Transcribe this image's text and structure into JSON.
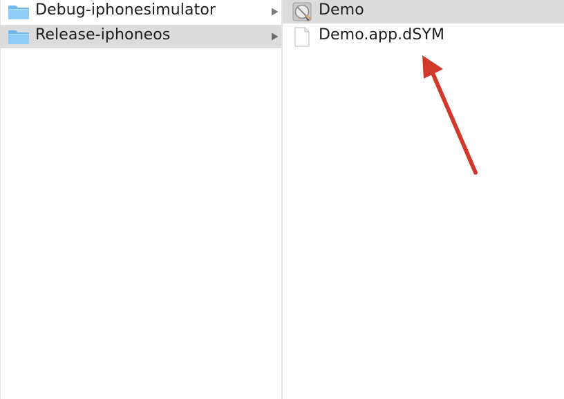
{
  "left_column": {
    "items": [
      {
        "label": "Debug-iphonesimulator",
        "icon": "folder-icon",
        "has_children": true,
        "selected": false
      },
      {
        "label": "Release-iphoneos",
        "icon": "folder-icon",
        "has_children": true,
        "selected": true
      }
    ]
  },
  "right_column": {
    "items": [
      {
        "label": "Demo",
        "icon": "executable-icon",
        "selected": true
      },
      {
        "label": "Demo.app.dSYM",
        "icon": "document-icon",
        "selected": false
      }
    ]
  },
  "annotation": {
    "shape": "arrow",
    "color": "#d0392b",
    "points_to": "Demo.app.dSYM"
  },
  "colors": {
    "selection_background": "#dcdcdc",
    "folder_blue": "#7cc1f3",
    "text": "#1d1d1d"
  }
}
